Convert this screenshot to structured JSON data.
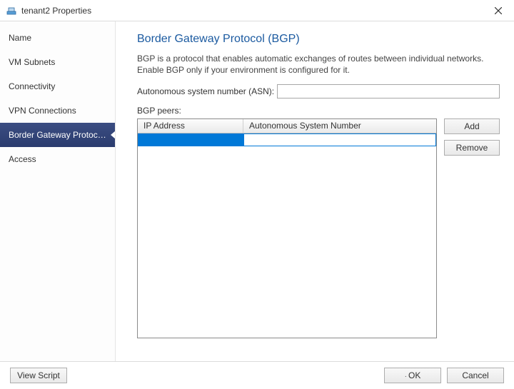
{
  "window": {
    "title": "tenant2 Properties",
    "close_label": "Close"
  },
  "sidebar": {
    "items": [
      {
        "label": "Name"
      },
      {
        "label": "VM Subnets"
      },
      {
        "label": "Connectivity"
      },
      {
        "label": "VPN Connections"
      },
      {
        "label": "Border Gateway Protocol..."
      },
      {
        "label": "Access"
      }
    ],
    "selected_index": 4
  },
  "main": {
    "heading": "Border Gateway Protocol (BGP)",
    "description": "BGP is a protocol that enables automatic exchanges of routes between individual networks. Enable BGP only if your environment is configured for it.",
    "asn_label": "Autonomous system number (ASN):",
    "asn_value": "",
    "peers_label": "BGP peers:",
    "grid": {
      "columns": [
        "IP Address",
        "Autonomous System Number"
      ],
      "rows": [
        {
          "ip": "",
          "asn": ""
        }
      ]
    },
    "buttons": {
      "add": "Add",
      "remove": "Remove"
    }
  },
  "footer": {
    "view_script": "View Script",
    "ok": "OK",
    "cancel": "Cancel"
  }
}
